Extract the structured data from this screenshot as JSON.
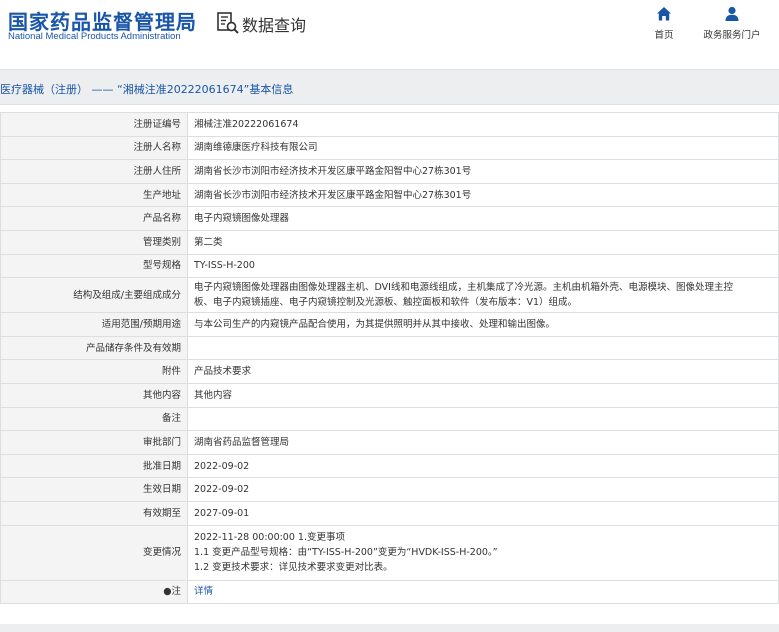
{
  "header": {
    "site_name_cn": "国家药品监督管理局",
    "site_name_en": "National Medical Products Administration",
    "query_title": "数据查询",
    "nav": [
      {
        "label": "首页",
        "icon": "home-icon"
      },
      {
        "label": "政务服务门户",
        "icon": "user-icon"
      }
    ]
  },
  "breadcrumb": "医疗器械（注册） —— “湘械注准20222061674”基本信息",
  "colors": {
    "brand": "#1a56a8",
    "label_bg": "#f4f4f5",
    "border": "#dcdfe2"
  },
  "rows": [
    {
      "label": "注册证编号",
      "value": "湘械注准20222061674"
    },
    {
      "label": "注册人名称",
      "value": "湖南维德康医疗科技有限公司"
    },
    {
      "label": "注册人住所",
      "value": "湖南省长沙市浏阳市经济技术开发区康平路金阳智中心27栋301号"
    },
    {
      "label": "生产地址",
      "value": "湖南省长沙市浏阳市经济技术开发区康平路金阳智中心27栋301号"
    },
    {
      "label": "产品名称",
      "value": "电子内窥镜图像处理器"
    },
    {
      "label": "管理类别",
      "value": "第二类"
    },
    {
      "label": "型号规格",
      "value": "TY-ISS-H-200"
    },
    {
      "label": "结构及组成/主要组成成分",
      "lines": [
        "电子内窥镜图像处理器由图像处理器主机、DVI线和电源线组成，主机集成了冷光源。主机由机箱外壳、电源模块、图像处理主控",
        "板、电子内窥镜插座、电子内窥镜控制及光源板、触控面板和软件（发布版本：V1）组成。"
      ]
    },
    {
      "label": "适用范围/预期用途",
      "value": "与本公司生产的内窥镜产品配合使用，为其提供照明并从其中接收、处理和输出图像。"
    },
    {
      "label": "产品储存条件及有效期",
      "value": ""
    },
    {
      "label": "附件",
      "value": "产品技术要求"
    },
    {
      "label": "其他内容",
      "value": "其他内容"
    },
    {
      "label": "备注",
      "value": ""
    },
    {
      "label": "审批部门",
      "value": "湖南省药品监督管理局"
    },
    {
      "label": "批准日期",
      "value": "2022-09-02"
    },
    {
      "label": "生效日期",
      "value": "2022-09-02"
    },
    {
      "label": "有效期至",
      "value": "2027-09-01"
    },
    {
      "label": "变更情况",
      "lines": [
        "2022-11-28 00:00:00 1.变更事项",
        "1.1 变更产品型号规格：由“TY-ISS-H-200”变更为“HVDK-ISS-H-200。”",
        "1.2 变更技术要求：详见技术要求变更对比表。"
      ]
    },
    {
      "label": "●注",
      "value": "详情",
      "link": true
    }
  ]
}
